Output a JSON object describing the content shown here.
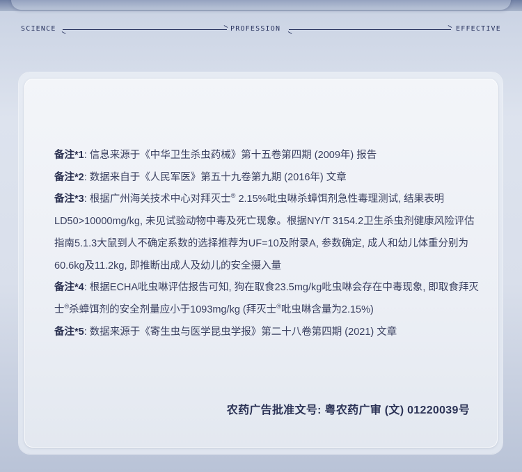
{
  "tagline": {
    "left": "SCIENCE",
    "center": "PROFESSION",
    "right": "EFFECTIVE"
  },
  "notes": [
    {
      "label": "备注*1",
      "text": ": 信息来源于《中华卫生杀虫药械》第十五卷第四期 (2009年) 报告"
    },
    {
      "label": "备注*2",
      "text": ": 数据来自于《人民军医》第五十九卷第九期 (2016年) 文章"
    },
    {
      "label": "备注*3",
      "text_before": ": 根据广州海关技术中心对拜灭士",
      "sup": "®",
      "text_after": " 2.15%吡虫啉杀蟑饵剂急性毒理测试, 结果表明LD50>10000mg/kg, 未见试验动物中毒及死亡现象。根据NY/T 3154.2卫生杀虫剂健康风险评估指南5.1.3大鼠到人不确定系数的选择推荐为UF=10及附录A, 参数确定, 成人和幼儿体重分别为60.6kg及11.2kg, 即推断出成人及幼儿的安全摄入量"
    },
    {
      "label": "备注*4",
      "text_a": ": 根据ECHA吡虫啉评估报告可知, 狗在取食23.5mg/kg吡虫啉会存在中毒现象, 即取食拜灭士",
      "sup_a": "®",
      "text_b": "杀蟑饵剂的安全剂量应小于1093mg/kg (拜灭士",
      "sup_b": "®",
      "text_c": "吡虫啉含量为2.15%)"
    },
    {
      "label": "备注*5",
      "text": ": 数据来源于《寄生虫与医学昆虫学报》第二十八卷第四期 (2021) 文章"
    }
  ],
  "approval": "农药广告批准文号: 粤农药广审 (文) 01220039号",
  "colors": {
    "text": "#3a4060",
    "heading": "#27325e",
    "background": "#d9dfeb",
    "card": "#eef1f6"
  }
}
